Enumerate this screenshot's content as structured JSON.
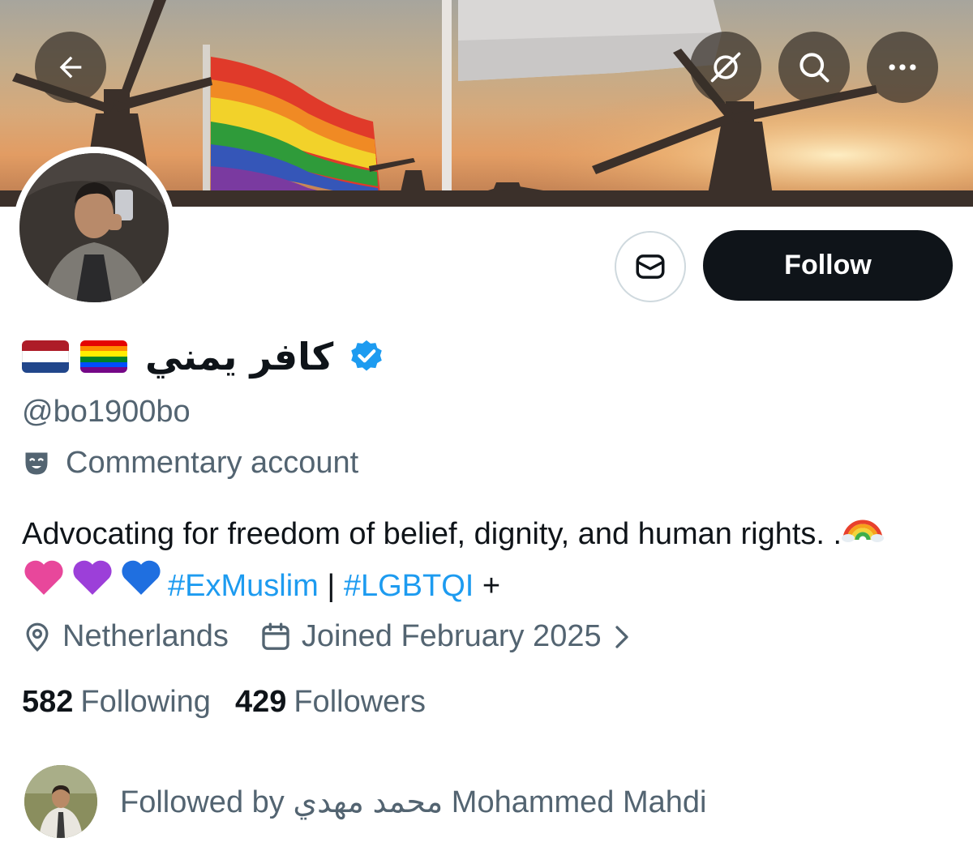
{
  "header": {
    "back_icon": "arrow-left-icon",
    "grok_icon": "grok-icon",
    "search_icon": "search-icon",
    "more_icon": "more-horizontal-icon"
  },
  "profile": {
    "display_name": "كافر يمني",
    "handle": "@bo1900bo",
    "account_label": "Commentary account",
    "bio_text": "Advocating for freedom of belief, dignity, and human rights. .",
    "bio_hashtag_1": "#ExMuslim",
    "bio_separator": "|",
    "bio_hashtag_2": "#LGBTQI",
    "bio_suffix": "+",
    "location": "Netherlands",
    "joined": "Joined February 2025",
    "following_count": "582",
    "following_label": "Following",
    "followers_count": "429",
    "followers_label": "Followers"
  },
  "actions": {
    "follow_label": "Follow",
    "message_icon": "envelope-icon"
  },
  "followed_by": {
    "text": "Followed by محمد مهدي Mohammed Mahdi"
  },
  "colors": {
    "accent": "#1d9bf0",
    "text_primary": "#0f1419",
    "text_secondary": "#536471",
    "follow_button": "#0f1419",
    "verified": "#1d9bf0"
  }
}
